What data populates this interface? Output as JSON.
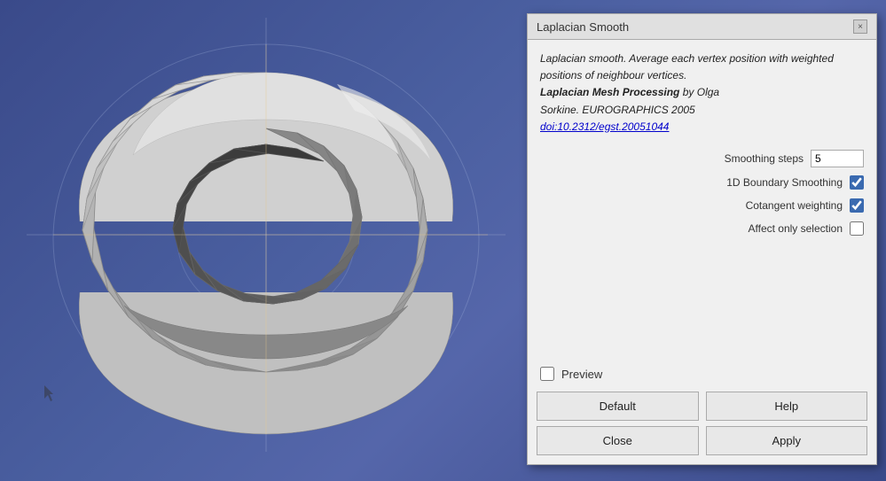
{
  "viewport": {
    "background": "3D mesh viewport"
  },
  "dialog": {
    "title": "Laplacian Smooth",
    "close_label": "×",
    "description_line1": "Laplacian smooth. Average each vertex",
    "description_line2": "position with weighted positions of",
    "description_line3": "neighbour vertices.",
    "description_bold": "Laplacian Mesh Processing",
    "description_author": " by Olga",
    "description_author2": "Sorkine. EUROGRAPHICS 2005",
    "description_link": "doi:10.2312/egst.20051044",
    "params": {
      "smoothing_steps_label": "Smoothing steps",
      "smoothing_steps_value": "5",
      "boundary_label": "1D Boundary Smoothing",
      "boundary_checked": true,
      "cotangent_label": "Cotangent weighting",
      "cotangent_checked": true,
      "selection_label": "Affect only selection",
      "selection_checked": false
    },
    "preview_label": "Preview",
    "preview_checked": false,
    "buttons": {
      "default_label": "Default",
      "help_label": "Help",
      "close_label": "Close",
      "apply_label": "Apply"
    }
  }
}
